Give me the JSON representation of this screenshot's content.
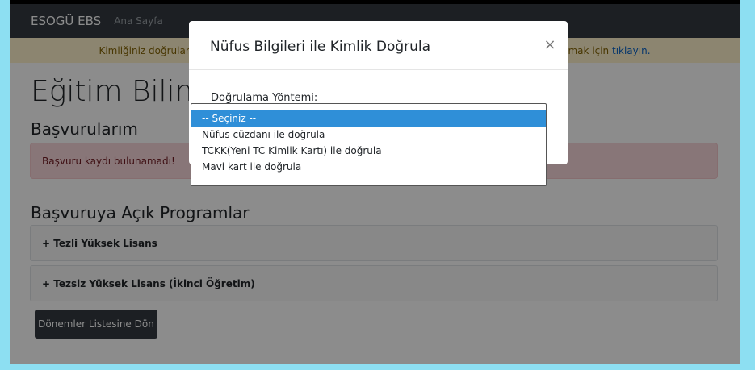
{
  "navbar": {
    "brand": "ESOGÜ EBS",
    "home_link": "Ana Sayfa"
  },
  "notice": {
    "text_left": "Kimliğiniz doğrular",
    "text_right": "lamak için",
    "link": "tıklayın."
  },
  "main": {
    "title": "Eğitim Biliml",
    "applications_heading": "Başvurularım",
    "no_record_alert": "Başvuru kaydı bulunamadı!",
    "open_programs_heading": "Başvuruya Açık Programlar",
    "programs": [
      {
        "label": "+ Tezli Yüksek Lisans"
      },
      {
        "label": "+ Tezsiz Yüksek Lisans (İkinci Öğretim)"
      }
    ],
    "back_button": "Dönemler Listesine Dön"
  },
  "modal": {
    "title": "Nüfus Bilgileri ile Kimlik Doğrula",
    "close": "×",
    "method_label": "Doğrulama Yöntemi:",
    "options": [
      "-- Seçiniz --",
      "Nüfus cüzdanı ile doğrula",
      "TCKK(Yeni TC Kimlik Kartı) ile doğrula",
      "Mavi kart ile doğrula"
    ],
    "selected_index": 0
  },
  "colors": {
    "navbar": "#343a40",
    "notice_bg": "#fff3cd",
    "danger_bg": "#f8d7da",
    "selected_option": "#2f8fd8",
    "frame": "#8ddff2"
  }
}
